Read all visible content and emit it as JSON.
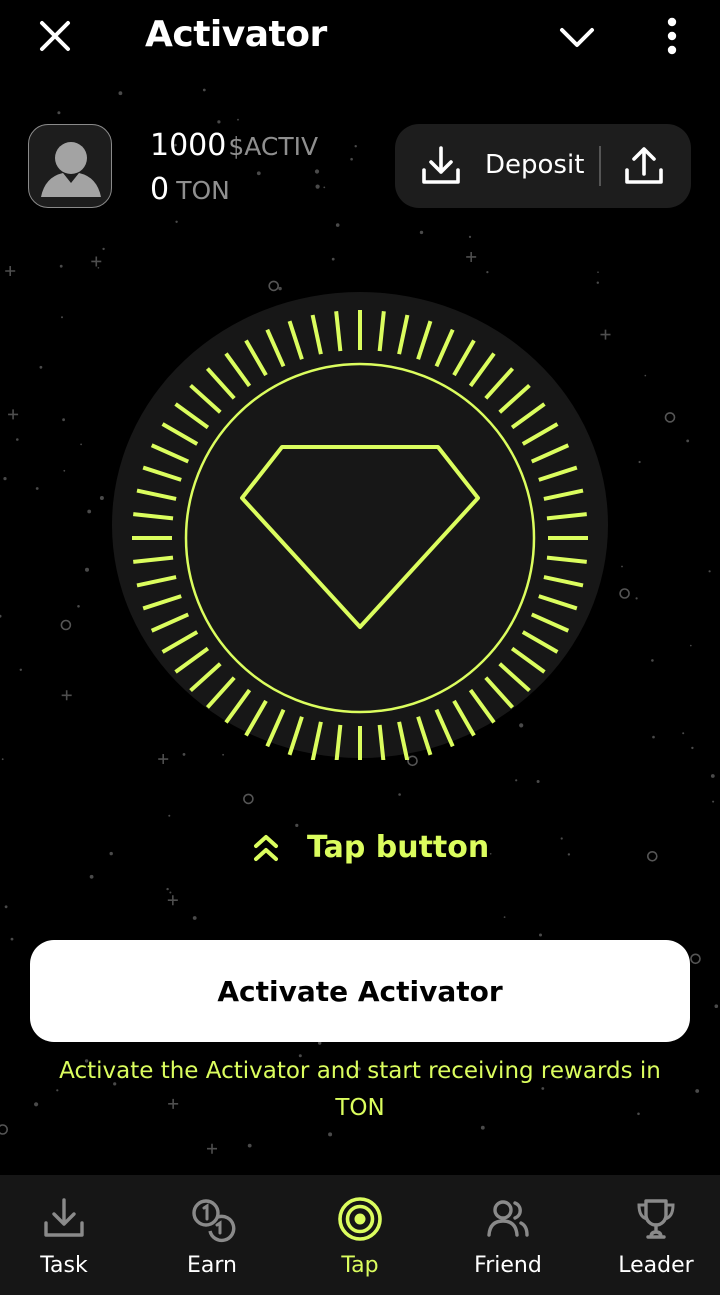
{
  "app": {
    "title": "Activator"
  },
  "colors": {
    "accent": "#dbfd5e",
    "background": "#000000",
    "panel": "#1d1d1d",
    "nav_bg": "#161616"
  },
  "header": {
    "close_icon": "close-icon",
    "collapse_icon": "chevron-down-icon",
    "menu_icon": "more-vertical-icon"
  },
  "balances": {
    "activ": {
      "amount": "1000",
      "unit": "$ACTIV"
    },
    "ton": {
      "amount": "0",
      "unit": "TON"
    }
  },
  "wallet": {
    "deposit_label": "Deposit",
    "deposit_icon": "download-icon",
    "withdraw_icon": "upload-icon"
  },
  "tapper": {
    "hint": "Tap button",
    "hint_icon": "double-chevron-up-icon",
    "center_icon": "diamond-icon"
  },
  "activate": {
    "button_label": "Activate Activator",
    "description": "Activate the Activator and start receiving rewards in TON"
  },
  "nav": {
    "active": "Tap",
    "items": [
      {
        "label": "Task",
        "icon": "download-tray-icon"
      },
      {
        "label": "Earn",
        "icon": "coins-icon"
      },
      {
        "label": "Tap",
        "icon": "target-icon"
      },
      {
        "label": "Friend",
        "icon": "friends-icon"
      },
      {
        "label": "Leader",
        "icon": "trophy-icon"
      }
    ]
  }
}
